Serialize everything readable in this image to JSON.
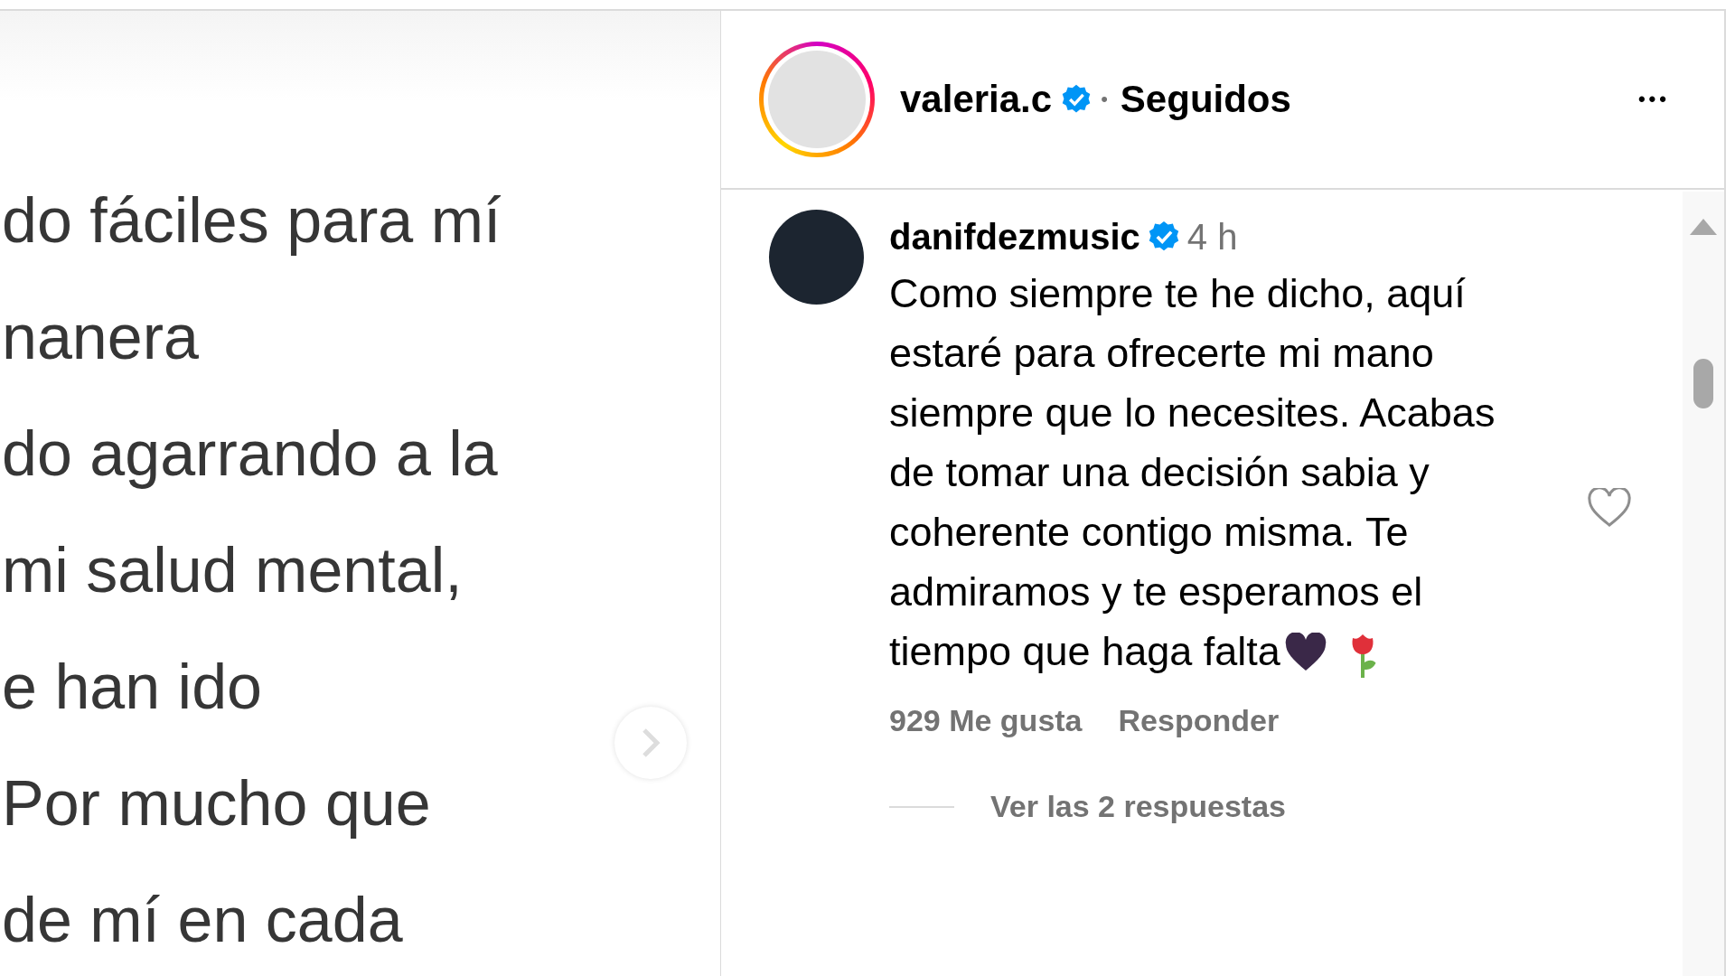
{
  "post_image": {
    "lines": [
      "do fáciles para mí",
      "nanera",
      "do agarrando a la",
      "mi salud mental,",
      "e han ido",
      "Por mucho que",
      "de mí en cada"
    ]
  },
  "header": {
    "username": "valeria.c",
    "verified": true,
    "separator": "•",
    "follow_status": "Seguidos",
    "more": "•••"
  },
  "comment": {
    "username": "danifdezmusic",
    "verified": true,
    "time": "4 h",
    "text": "Como siempre te he dicho, aquí estaré para ofrecerte mi mano siempre que lo necesites. Acabas de tomar una decisión sabia y coherente contigo misma. Te admiramos y te esperamos el tiempo que haga falta",
    "likes": "929 Me gusta",
    "reply": "Responder",
    "liked": false,
    "view_replies": "Ver las 2 respuestas"
  }
}
